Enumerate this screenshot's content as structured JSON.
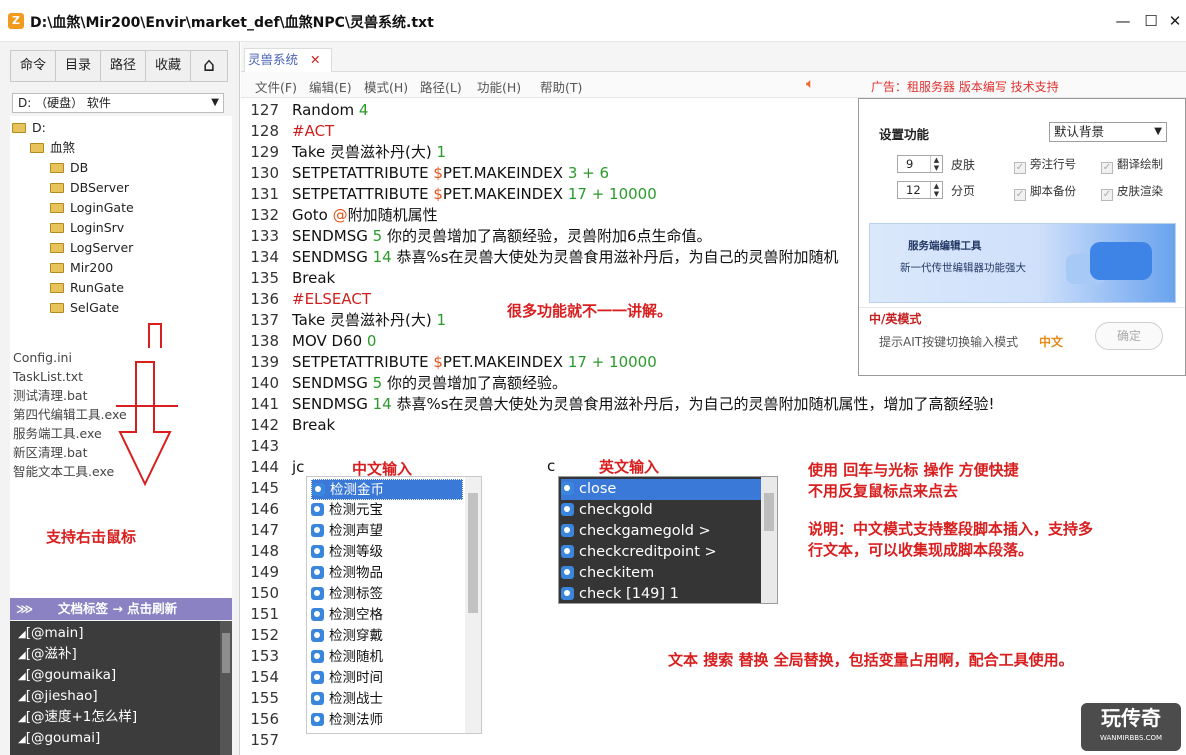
{
  "window": {
    "app_icon": "Z",
    "title": "D:\\血煞\\Mir200\\Envir\\market_def\\血煞NPC\\灵兽系统.txt",
    "minimize": "—",
    "maximize": "☐",
    "close": "✕"
  },
  "nav": {
    "buttons": [
      "命令",
      "目录",
      "路径",
      "收藏"
    ],
    "home": "⌂"
  },
  "drive_select": "D: （硬盘） 软件",
  "tree": {
    "root": "D:",
    "parent": "血煞",
    "folders": [
      "DB",
      "DBServer",
      "LoginGate",
      "LoginSrv",
      "LogServer",
      "Mir200",
      "RunGate",
      "SelGate"
    ]
  },
  "files": [
    "Config.ini",
    "TaskList.txt",
    "测试清理.bat",
    "第四代编辑工具.exe",
    "服务端工具.exe",
    "新区清理.bat",
    "智能文本工具.exe"
  ],
  "right_click_note": "支持右击鼠标",
  "tags": {
    "header": "文档标签 → 点击刷新",
    "items": [
      "[@main]",
      "[@滋补]",
      "[@goumaika]",
      "[@jieshao]",
      "[@速度+1怎么样]",
      "[@goumai]"
    ]
  },
  "doc_tab": {
    "label": "灵兽系统",
    "close": "✕"
  },
  "menu": [
    "文件(F)",
    "编辑(E)",
    "模式(H)",
    "路径(L)",
    "功能(H)",
    "帮助(T)"
  ],
  "ad": "广告：租服务器 版本编写 技术支持",
  "code_lines": [
    {
      "n": "127",
      "parts": [
        {
          "t": "Random "
        },
        {
          "t": "4",
          "c": "num"
        }
      ]
    },
    {
      "n": "128",
      "parts": [
        {
          "t": "#ACT",
          "c": "kw-red"
        }
      ]
    },
    {
      "n": "129",
      "parts": [
        {
          "t": "Take 灵兽滋补丹(大) "
        },
        {
          "t": "1",
          "c": "num"
        }
      ]
    },
    {
      "n": "130",
      "parts": [
        {
          "t": "SETPETATTRIBUTE "
        },
        {
          "t": "$",
          "c": "sym"
        },
        {
          "t": "PET.MAKEINDEX "
        },
        {
          "t": "3 + 6",
          "c": "num"
        }
      ]
    },
    {
      "n": "131",
      "parts": [
        {
          "t": "SETPETATTRIBUTE "
        },
        {
          "t": "$",
          "c": "sym"
        },
        {
          "t": "PET.MAKEINDEX "
        },
        {
          "t": "17 + 10000",
          "c": "num"
        }
      ]
    },
    {
      "n": "132",
      "parts": [
        {
          "t": "Goto "
        },
        {
          "t": "@",
          "c": "sym"
        },
        {
          "t": "附加随机属性"
        }
      ]
    },
    {
      "n": "133",
      "parts": [
        {
          "t": "SENDMSG "
        },
        {
          "t": "5",
          "c": "num"
        },
        {
          "t": " 你的灵兽增加了高额经验，灵兽附加6点生命值。"
        }
      ]
    },
    {
      "n": "134",
      "parts": [
        {
          "t": "SENDMSG "
        },
        {
          "t": "14",
          "c": "num"
        },
        {
          "t": " 恭喜%s在灵兽大使处为灵兽食用滋补丹后，为自己的灵兽附加随机"
        }
      ]
    },
    {
      "n": "135",
      "parts": [
        {
          "t": "Break"
        }
      ]
    },
    {
      "n": "136",
      "parts": [
        {
          "t": "#ELSEACT",
          "c": "kw-red"
        }
      ]
    },
    {
      "n": "137",
      "parts": [
        {
          "t": "Take 灵兽滋补丹(大) "
        },
        {
          "t": "1",
          "c": "num"
        }
      ]
    },
    {
      "n": "138",
      "parts": [
        {
          "t": "MOV D60 "
        },
        {
          "t": "0",
          "c": "num"
        }
      ]
    },
    {
      "n": "139",
      "parts": [
        {
          "t": "SETPETATTRIBUTE "
        },
        {
          "t": "$",
          "c": "sym"
        },
        {
          "t": "PET.MAKEINDEX "
        },
        {
          "t": "17 + 10000",
          "c": "num"
        }
      ]
    },
    {
      "n": "140",
      "parts": [
        {
          "t": "SENDMSG "
        },
        {
          "t": "5",
          "c": "num"
        },
        {
          "t": " 你的灵兽增加了高额经验。"
        }
      ]
    },
    {
      "n": "141",
      "parts": [
        {
          "t": "SENDMSG "
        },
        {
          "t": "14",
          "c": "num"
        },
        {
          "t": " 恭喜%s在灵兽大使处为灵兽食用滋补丹后，为自己的灵兽附加随机属性，增加了高额经验!"
        }
      ]
    },
    {
      "n": "142",
      "parts": [
        {
          "t": "Break"
        }
      ]
    },
    {
      "n": "143",
      "parts": [
        {
          "t": ""
        }
      ]
    },
    {
      "n": "144",
      "parts": [
        {
          "t": "jc"
        }
      ]
    },
    {
      "n": "145",
      "parts": [
        {
          "t": ""
        }
      ]
    },
    {
      "n": "146",
      "parts": [
        {
          "t": ""
        }
      ]
    },
    {
      "n": "147",
      "parts": [
        {
          "t": ""
        }
      ]
    },
    {
      "n": "148",
      "parts": [
        {
          "t": ""
        }
      ]
    },
    {
      "n": "149",
      "parts": [
        {
          "t": ""
        }
      ]
    },
    {
      "n": "150",
      "parts": [
        {
          "t": ""
        }
      ]
    },
    {
      "n": "151",
      "parts": [
        {
          "t": ""
        }
      ]
    },
    {
      "n": "152",
      "parts": [
        {
          "t": ""
        }
      ]
    },
    {
      "n": "153",
      "parts": [
        {
          "t": ""
        }
      ]
    },
    {
      "n": "154",
      "parts": [
        {
          "t": ""
        }
      ]
    },
    {
      "n": "155",
      "parts": [
        {
          "t": ""
        }
      ]
    },
    {
      "n": "156",
      "parts": [
        {
          "t": ""
        }
      ]
    },
    {
      "n": "157",
      "parts": [
        {
          "t": ""
        }
      ]
    }
  ],
  "en_prefix": "c",
  "settings": {
    "title": "设置功能",
    "background": "默认背景",
    "skin_value": "9",
    "skin_label": "皮肤",
    "page_value": "12",
    "page_label": "分页",
    "checks": [
      "旁注行号",
      "翻译绘制",
      "脚本备份",
      "皮肤渲染"
    ],
    "banner_title": "服务端编辑工具",
    "banner_sub": "新一代传世编辑器功能强大",
    "mode_title": "中/英模式",
    "mode_desc": "提示AIT按键切换输入模式",
    "mode_value": "中文",
    "ok": "确定"
  },
  "annotations": {
    "many_features": "很多功能就不一一讲解。",
    "cn_input": "中文输入",
    "en_input": "英文输入",
    "usage_1": "使用  回车与光标  操作    方便快捷",
    "usage_2": "不用反复鼠标点来点去",
    "explain_1": "说明：中文模式支持整段脚本插入，支持多",
    "explain_2": "行文本，可以收集现成脚本段落。",
    "search": "文本  搜索  替换    全局替换，包括变量占用啊，配合工具使用。"
  },
  "cn_popup": [
    "检测金币",
    "检测元宝",
    "检测声望",
    "检测等级",
    "检测物品",
    "检测标签",
    "检测空格",
    "检测穿戴",
    "检测随机",
    "检测时间",
    "检测战士",
    "检测法师"
  ],
  "en_popup": [
    "close",
    "checkgold",
    "checkgamegold >",
    "checkcreditpoint >",
    "checkitem",
    "check [149] 1"
  ],
  "watermark": {
    "big": "玩传奇",
    "small": "WANMIRBBS.COM"
  },
  "colors": {
    "annotation_red": "#d81e1e",
    "selection_blue": "#3a79d8",
    "tag_header": "#8a82c2"
  }
}
